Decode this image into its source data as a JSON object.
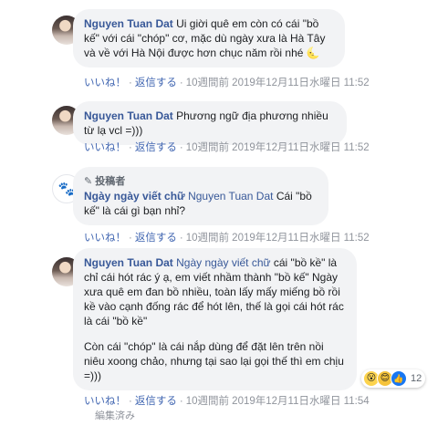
{
  "comments": [
    {
      "author": "Nguyen Tuan Dat",
      "text": "Ui giời quê em còn có cái \"bồ kế\" với cái \"chóp\" cơ, mặc dù ngày xưa là Hà Tây và về với Hà Nội được hơn chục năm rồi nhé",
      "emoji": "🌜",
      "like_label": "いいね！",
      "reply_label": "返信する",
      "time": "10週間前 2019年12月11日水曜日 11:52"
    },
    {
      "author": "Nguyen Tuan Dat",
      "text": "Phương ngữ địa phương nhiều từ lạ vcl =)))",
      "like_label": "いいね！",
      "reply_label": "返信する",
      "time": "10週間前 2019年12月11日水曜日 11:52"
    },
    {
      "author_tag": "投稿者",
      "author": "Ngày ngày viết chữ",
      "mention": "Nguyen Tuan Dat",
      "text": " Cái \"bồ kế\" là cái gì bạn nhỉ?",
      "like_label": "いいね！",
      "reply_label": "返信する",
      "time": "10週間前 2019年12月11日水曜日 11:52"
    },
    {
      "author": "Nguyen Tuan Dat",
      "mention": "Ngày ngày viết chữ",
      "text": " cái \"bồ kề\" là chỉ cái hót rác ý ạ, em viết nhầm thành \"bồ kế\" Ngày xưa quê em đan bồ nhiều, toàn lấy mấy miếng bồ rồi kề vào cạnh đống rác để hót lên, thế là gọi cái hót rác là cái \"bồ kề\"",
      "text2": "Còn cái \"chóp\" là cái nắp dùng để đặt lên trên nồi niêu xoong chảo, nhưng tại sao lại gọi thế thì em chịu =)))",
      "reaction_count": "12",
      "like_label": "いいね！",
      "reply_label": "返信する",
      "time": "10週間前 2019年12月11日水曜日 11:54",
      "edited_label": "編集済み"
    }
  ],
  "icons": {
    "page_avatar": "cat-paw-icon",
    "author_tag": "pencil-icon",
    "reactions": [
      "wow-reaction-icon",
      "care-reaction-icon",
      "like-reaction-icon"
    ]
  },
  "colors": {
    "name": "#385898",
    "bubble": "#f2f3f5",
    "meta": "#90949c",
    "action": "#4267b2"
  }
}
